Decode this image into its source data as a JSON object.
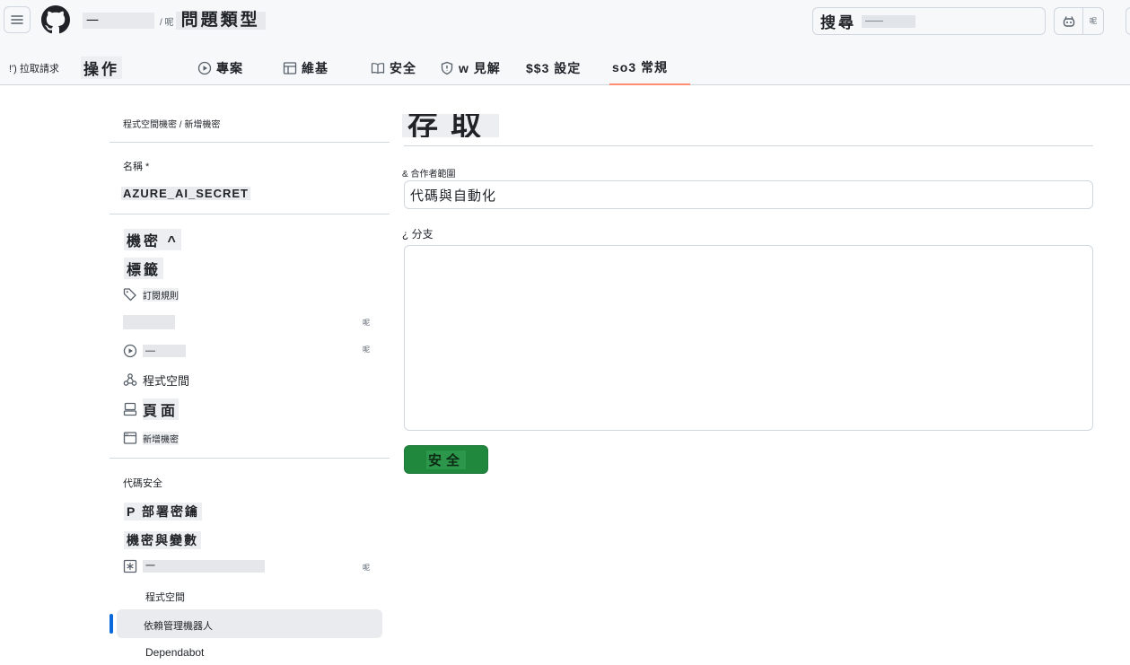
{
  "header": {
    "repo_owner": "一",
    "repo_separator": "/ 呢",
    "repo_name": "問題類型",
    "search_label": "搜尋",
    "search_hint": "——",
    "copilot_more": "呢"
  },
  "repo_nav": {
    "pull_requests": "!') 拉取請求",
    "actions": "操作",
    "projects": "專案",
    "wiki": "維基",
    "security": "安全",
    "insights": "w 見解",
    "settings_prefix": "$$3 設定",
    "general": "so3 常規"
  },
  "sidebar": {
    "caption": "程式空間機密 / 新增機密",
    "name_label": "名稱 *",
    "secret_name": "AZURE_AI_SECRET",
    "secret_label": "機密 ^",
    "tags_label": "標籤",
    "items": {
      "rules": "訂閱規則",
      "actions": "—",
      "codespaces": "程式空間",
      "pages": "頁面",
      "new_secret": "新增機密"
    },
    "tags": {
      "chevron": "呢",
      "actions": "呢",
      "secrets": "呢"
    },
    "code_security_heading": "代碼安全",
    "deploy_keys": "P 部署密鑰",
    "secrets_and_vars": "機密與變數",
    "secrets_item": "一",
    "subitems": {
      "codespaces": "程式空間",
      "dependabot_bot": "依賴管理機器人",
      "dependabot": "Dependabot"
    }
  },
  "main": {
    "title": "存取",
    "field1_label": "& 合作者範圍",
    "field1_value": "代碼與自動化",
    "field2_label": "¿ 分支",
    "textarea_value": "",
    "save_label": "安全"
  },
  "colors": {
    "accent_active": "#fd8c73",
    "primary_button": "#1f883d",
    "active_indicator": "#0969da"
  }
}
